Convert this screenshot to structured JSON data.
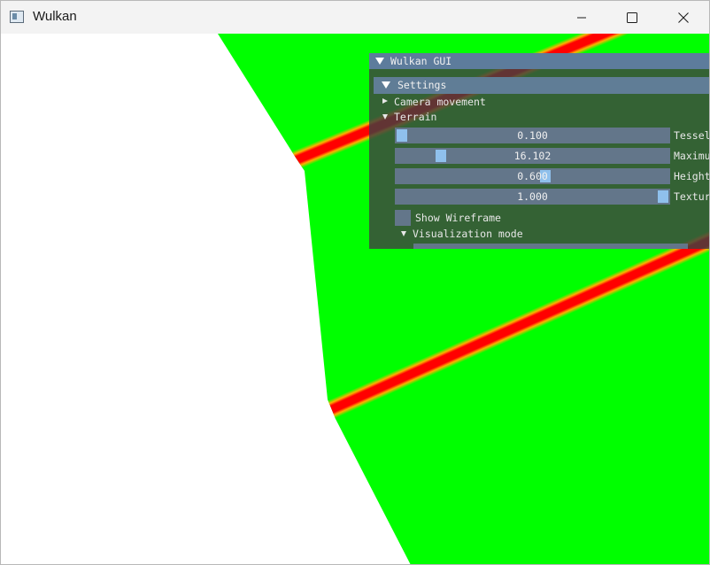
{
  "window": {
    "title": "Wulkan",
    "icon": "app-window-icon",
    "buttons": [
      "minimize-icon",
      "maximize-icon",
      "close-icon"
    ]
  },
  "gui": {
    "title": "Wulkan GUI",
    "settings": {
      "label": "Settings",
      "camera_movement": "Camera movement",
      "terrain": {
        "label": "Terrain",
        "sliders": [
          {
            "display": "0.100",
            "fraction": 0.0,
            "label": "Tessel"
          },
          {
            "display": "16.102",
            "fraction": 0.15,
            "label": "Maximu"
          },
          {
            "display": "0.600",
            "fraction": 0.55,
            "label": "Height"
          },
          {
            "display": "1.000",
            "fraction": 1.0,
            "label": "Textur"
          }
        ],
        "show_wireframe": {
          "label": "Show Wireframe",
          "checked": false
        },
        "visualization_mode": "Visualization mode"
      }
    }
  },
  "colors": {
    "terrain_green": "#00ff00",
    "band_red": "#ff0000",
    "gui_title": "#5d7c9c",
    "slider_grab": "#8fc0ec"
  }
}
